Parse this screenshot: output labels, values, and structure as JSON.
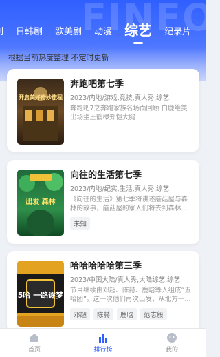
{
  "header": {
    "bg_text": "FINFO",
    "tabs": [
      {
        "label": "剧",
        "active": false
      },
      {
        "label": "日韩剧",
        "active": false
      },
      {
        "label": "欧美剧",
        "active": false
      },
      {
        "label": "动漫",
        "active": false
      },
      {
        "label": "综艺",
        "active": true
      },
      {
        "label": "纪录片",
        "active": false
      }
    ],
    "subtitle": "根据当前热度整理 不定时更新"
  },
  "cards": [
    {
      "title": "奔跑吧第七季",
      "meta": "2023/内地/游戏,竞技,真人秀,综艺",
      "desc": "奔跑吧7之奔跑家族名场面回顾 白鹿绝美出场坐王鹤棣郑恺大腿",
      "tags": [],
      "poster_text": "开启美好奇妙旅程"
    },
    {
      "title": "向往的生活第七季",
      "meta": "2023/内地/纪实,生活,真人秀,综艺",
      "desc": "《向往的生活》第七季将讲述蘑菇屋与森林的故事，蘑菇屋的家人们将去到森林...",
      "tags": [
        "未知"
      ],
      "poster_text": "出发 森林"
    },
    {
      "title": "哈哈哈哈哈第三季",
      "meta": "2023/中国大陆/真人秀,大陆综艺,综艺",
      "desc": "节目继续由邓超、陈赫、鹿晗等人组成“五哈团”。这一次他们再次出发，从北方一...",
      "tags": [
        "邓超",
        "陈赫",
        "鹿晗",
        "范志毅"
      ],
      "poster_text": "5哈 一路逐梦"
    }
  ],
  "bottom_nav": [
    {
      "label": "首页",
      "icon": "home-icon",
      "active": false
    },
    {
      "label": "排行榜",
      "icon": "ranking-icon",
      "active": true
    },
    {
      "label": "我的",
      "icon": "profile-icon",
      "active": false
    }
  ],
  "colors": {
    "accent": "#2f5fff",
    "background": "#eef1f6"
  }
}
